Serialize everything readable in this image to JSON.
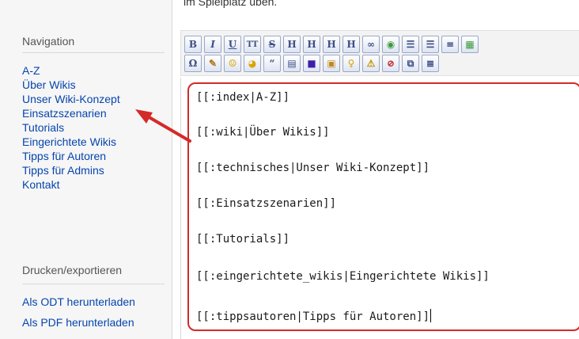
{
  "intro_text": "im Spielplatz üben.",
  "sidebar": {
    "navigation_heading": "Navigation",
    "nav_items": [
      {
        "label": "A-Z"
      },
      {
        "label": "Über Wikis"
      },
      {
        "label": "Unser Wiki-Konzept"
      },
      {
        "label": "Einsatzszenarien"
      },
      {
        "label": "Tutorials"
      },
      {
        "label": "Eingerichtete Wikis"
      },
      {
        "label": "Tipps für Autoren"
      },
      {
        "label": "Tipps für Admins"
      },
      {
        "label": "Kontakt"
      }
    ],
    "print_heading": "Drucken/exportieren",
    "print_items": [
      {
        "label": "Als ODT herunterladen"
      },
      {
        "label": "Als PDF herunterladen"
      }
    ]
  },
  "toolbar": {
    "row1": [
      {
        "icon": "bold-icon",
        "glyph": "B"
      },
      {
        "icon": "italic-icon",
        "glyph": "I"
      },
      {
        "icon": "underline-icon",
        "glyph": "U"
      },
      {
        "icon": "monospace-icon",
        "glyph": "TT"
      },
      {
        "icon": "strikethrough-icon",
        "glyph": "S"
      },
      {
        "icon": "heading-same-level-icon",
        "glyph": "H"
      },
      {
        "icon": "heading-lower-level-icon",
        "glyph": "H"
      },
      {
        "icon": "heading-higher-level-icon",
        "glyph": "H"
      },
      {
        "icon": "heading-menu-icon",
        "glyph": "H"
      },
      {
        "icon": "internal-link-icon",
        "glyph": "∞"
      },
      {
        "icon": "external-link-icon",
        "glyph": "◉"
      },
      {
        "icon": "ordered-list-icon",
        "glyph": "☰"
      },
      {
        "icon": "unordered-list-icon",
        "glyph": "☰"
      },
      {
        "icon": "horizontal-rule-icon",
        "glyph": "≡"
      },
      {
        "icon": "image-icon",
        "glyph": "▦"
      }
    ],
    "row2": [
      {
        "icon": "special-chars-icon",
        "glyph": "Ω"
      },
      {
        "icon": "edit-icon",
        "glyph": "✎"
      },
      {
        "icon": "smiley-icon",
        "glyph": "☺"
      },
      {
        "icon": "smiley-alt-icon",
        "glyph": "◕"
      },
      {
        "icon": "quote-icon",
        "glyph": "“"
      },
      {
        "icon": "table-icon",
        "glyph": "▤"
      },
      {
        "icon": "color-box-icon",
        "glyph": "■"
      },
      {
        "icon": "note-icon",
        "glyph": "▣"
      },
      {
        "icon": "tip-icon",
        "glyph": "♀"
      },
      {
        "icon": "warning-icon",
        "glyph": "⚠"
      },
      {
        "icon": "stop-icon",
        "glyph": "⊘"
      },
      {
        "icon": "clapper-icon",
        "glyph": "⧉"
      },
      {
        "icon": "align-icon",
        "glyph": "≣"
      }
    ]
  },
  "editor": {
    "lines": [
      "[[:index|A-Z]]",
      "[[:wiki|Über Wikis]]",
      "[[:technisches|Unser Wiki-Konzept]]",
      "[[:Einsatzszenarien]]",
      "[[:Tutorials]]",
      "[[:eingerichtete_wikis|Eingerichtete Wikis]]",
      "[[:tippsautoren|Tipps für Autoren]]"
    ]
  },
  "colors": {
    "link": "#0645ad",
    "highlight_frame": "#d42a2a",
    "arrow": "#d42a2a"
  }
}
